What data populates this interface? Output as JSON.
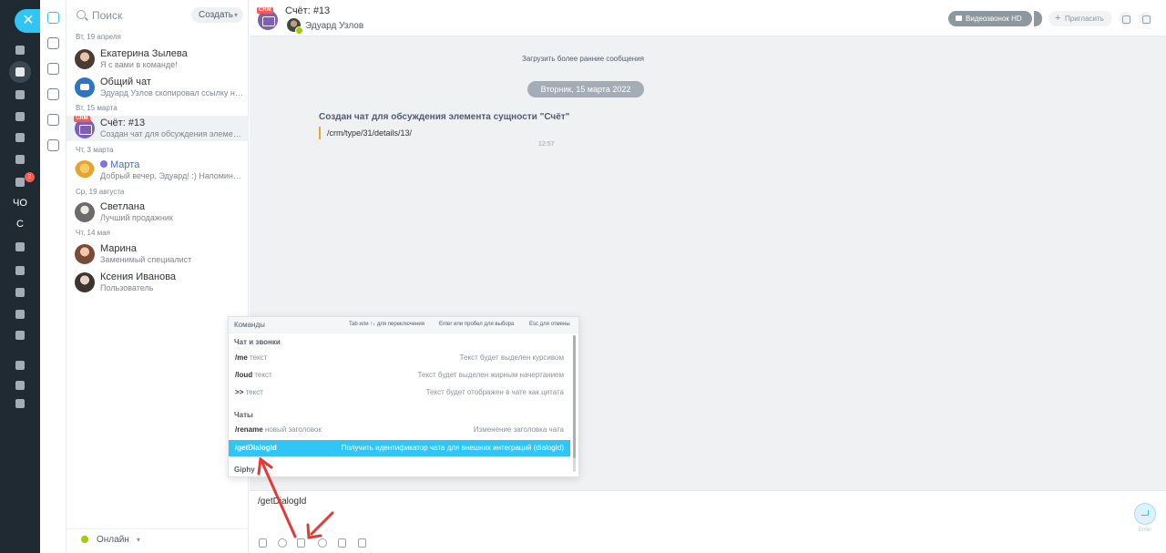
{
  "sidebar": {
    "close_glyph": "✕",
    "badge": "2",
    "initials_1": "ЧО",
    "initials_2": "С"
  },
  "recent": {
    "search_placeholder": "Поиск",
    "create_label": "Создать",
    "groups": [
      {
        "date": "Вт, 19 апреля",
        "items": [
          {
            "name": "Екатерина Зылева",
            "message": "Я с вами в команде!"
          },
          {
            "name": "Общий чат",
            "message": "Эдуард Узлов скопировал ссылку на..."
          }
        ]
      },
      {
        "date": "Вт, 15 марта",
        "items": [
          {
            "name": "Счёт: #13",
            "message": "Создан чат для обсуждения элемента..."
          }
        ]
      },
      {
        "date": "Чт, 3 марта",
        "items": [
          {
            "name": "Марта",
            "message": "Добрый вечер, Эдуард! :) Напоминаю..."
          }
        ]
      },
      {
        "date": "Ср, 19 августа",
        "items": [
          {
            "name": "Светлана",
            "message": "Лучший продажник"
          }
        ]
      },
      {
        "date": "Чт, 14 мая",
        "items": [
          {
            "name": "Марина",
            "message": "Заменимый специалист"
          },
          {
            "name": "Ксения Иванова",
            "message": "Пользователь"
          }
        ]
      }
    ],
    "crm_tag": "CRM",
    "status": "Онлайн"
  },
  "chat": {
    "title": "Счёт: #13",
    "crm_tag": "CRM",
    "user": "Эдуард Узлов",
    "video_button": "Видеозвонок HD",
    "invite_button": "Пригласить",
    "load_more": "Загрузить более ранние сообщения",
    "date_divider": "Вторник, 15 марта 2022",
    "system_title": "Создан чат для обсуждения элемента сущности \"Счёт\"",
    "system_link": "/crm/type/31/details/13/",
    "system_time": "12:57"
  },
  "commands": {
    "header": "Команды",
    "hint_tab": "Tab или ↑↓ для переключения",
    "hint_enter": "Enter или пробел для выбора",
    "hint_esc": "Esc для отмены",
    "categories": {
      "chat": "Чат и звонки",
      "chats": "Чаты",
      "giphy": "Giphy"
    },
    "rows": [
      {
        "cmd": "/me",
        "arg": "текст",
        "desc": "Текст будет выделен курсивом"
      },
      {
        "cmd": "/loud",
        "arg": "текст",
        "desc": "Текст будет выделен жирным начертанием"
      },
      {
        "cmd": ">>",
        "arg": "текст",
        "desc": "Текст будет отображен в чате как цитата"
      },
      {
        "cmd": "/rename",
        "arg": "новый заголовок",
        "desc": "Изменение заголовка чата"
      },
      {
        "cmd": "/getDialogId",
        "arg": "",
        "desc": "Получить идентификатор чата для внешних интеграций (dialogId)"
      }
    ]
  },
  "composer": {
    "value": "/getDialogId",
    "send_label": "Enter"
  },
  "colors": {
    "accent": "#2fc6f6",
    "rail": "#1f2a33",
    "annotation": "#e53935"
  }
}
